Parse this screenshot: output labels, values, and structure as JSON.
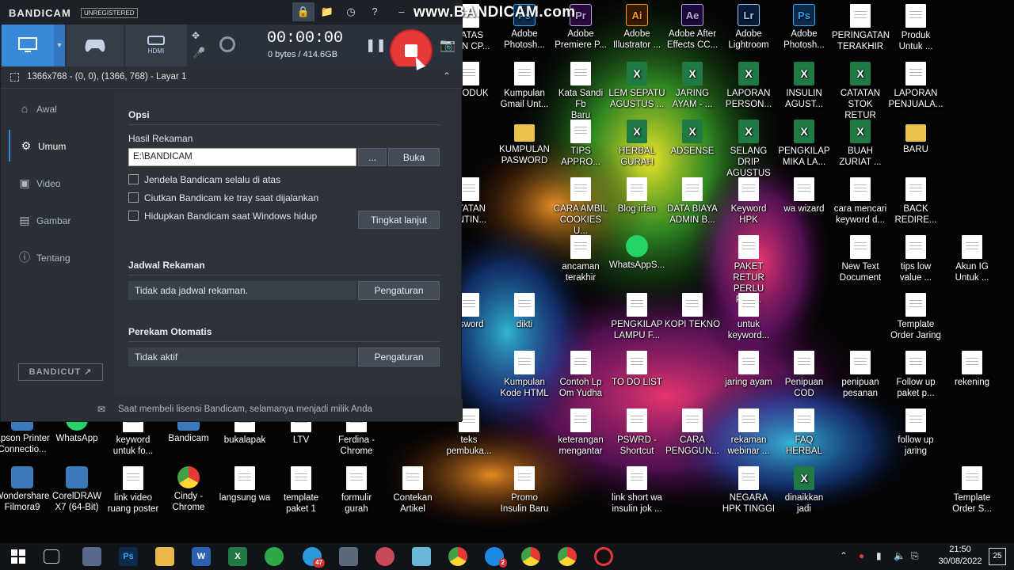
{
  "colors": {
    "accent": "#3a88d8",
    "record": "#e8393a",
    "panel": "#2b2f36"
  },
  "watermark": "www.BANDICAM.com",
  "bandicam": {
    "logo": "BANDICAM",
    "unregistered": "UNREGISTERED",
    "titlebar_icons": [
      "lock-icon",
      "folder-icon",
      "clock-icon",
      "help-icon",
      "minimize-icon"
    ],
    "modes": {
      "hdmi_label": "HDMI"
    },
    "timer": "00:00:00",
    "size": "0 bytes / 414.6GB",
    "area": "1366x768 - (0, 0), (1366, 768) - Layar 1",
    "sidebar": [
      {
        "label": "Awal",
        "icon": "home-icon"
      },
      {
        "label": "Umum",
        "icon": "gear-icon",
        "active": true
      },
      {
        "label": "Video",
        "icon": "video-icon"
      },
      {
        "label": "Gambar",
        "icon": "image-icon"
      },
      {
        "label": "Tentang",
        "icon": "info-icon"
      }
    ],
    "bandicut": "BANDICUT",
    "content": {
      "opsi_title": "Opsi",
      "hasil_label": "Hasil Rekaman",
      "path_value": "E:\\BANDICAM",
      "browse_label": "...",
      "buka_label": "Buka",
      "checks": [
        "Jendela Bandicam selalu di atas",
        "Ciutkan Bandicam ke tray saat dijalankan",
        "Hidupkan Bandicam saat Windows hidup"
      ],
      "advanced_label": "Tingkat lanjut",
      "schedule_title": "Jadwal Rekaman",
      "schedule_value": "Tidak ada jadwal rekaman.",
      "schedule_btn": "Pengaturan",
      "auto_title": "Perekam Otomatis",
      "auto_value": "Tidak aktif",
      "auto_btn": "Pengaturan"
    },
    "footer": "Saat membeli lisensi Bandicam, selamanya menjadi milik Anda"
  },
  "desktop_icons": [
    {
      "label": "BATAS\nMAN CP...",
      "type": "doc"
    },
    {
      "label": "Adobe\nPhotosh...",
      "type": "ps"
    },
    {
      "label": "Adobe\nPremiere P...",
      "type": "pr"
    },
    {
      "label": "Adobe\nIllustrator ...",
      "type": "ai"
    },
    {
      "label": "Adobe After\nEffects CC...",
      "type": "ae"
    },
    {
      "label": "Adobe\nLightroom",
      "type": "lr"
    },
    {
      "label": "Adobe\nPhotosh...",
      "type": "ps"
    },
    {
      "label": "PERINGATAN\nTERAKHIR",
      "type": "doc"
    },
    {
      "label": "Produk\nUntuk ...",
      "type": "doc"
    },
    {
      "label": "PRODUK",
      "type": "doc"
    },
    {
      "label": "Kumpulan\nGmail Unt...",
      "type": "doc"
    },
    {
      "label": "Kata Sandi Fb\nBaru",
      "type": "doc"
    },
    {
      "label": "LEM SEPATU\nAGUSTUS ...",
      "type": "xls"
    },
    {
      "label": "JARING\nAYAM - ...",
      "type": "xls"
    },
    {
      "label": "LAPORAN\nPERSON...",
      "type": "xls"
    },
    {
      "label": "INSULIN\nAGUST...",
      "type": "xls"
    },
    {
      "label": "CATATAN\nSTOK RETUR",
      "type": "xls"
    },
    {
      "label": "LAPORAN\nPENJUALA...",
      "type": "doc"
    },
    {
      "label": "KUMPULAN\nPASWORD",
      "type": "folder"
    },
    {
      "label": "TIPS\nAPPRO...",
      "type": "doc"
    },
    {
      "label": "HERBAL\nGURAH",
      "type": "xls"
    },
    {
      "label": "ADSENSE",
      "type": "xls"
    },
    {
      "label": "SELANG DRIP\nAGUSTUS 2...",
      "type": "xls"
    },
    {
      "label": "PENGKILAP\nMIKA LA...",
      "type": "xls"
    },
    {
      "label": "BUAH\nZURIAT ...",
      "type": "xls"
    },
    {
      "label": "BARU",
      "type": "folder"
    },
    {
      "label": "ATATAN\nENTIN...",
      "type": "doc"
    },
    {
      "label": "CARA AMBIL\nCOOKIES U...",
      "type": "doc"
    },
    {
      "label": "Blog irfan",
      "type": "doc"
    },
    {
      "label": "DATA BIAYA\nADMIN B...",
      "type": "doc"
    },
    {
      "label": "Keyword\nHPK",
      "type": "doc"
    },
    {
      "label": "wa wizard",
      "type": "doc"
    },
    {
      "label": "cara mencari\nkeyword d...",
      "type": "doc"
    },
    {
      "label": "BACK\nREDIRE...",
      "type": "doc"
    },
    {
      "label": "ancaman\nterakhir",
      "type": "doc"
    },
    {
      "label": "WhatsAppS...",
      "type": "wa"
    },
    {
      "label": "PAKET RETUR\nPERLU PAN...",
      "type": "doc"
    },
    {
      "label": "New Text\nDocument",
      "type": "doc"
    },
    {
      "label": "tips low\nvalue ...",
      "type": "doc"
    },
    {
      "label": "Akun IG\nUntuk ...",
      "type": "doc"
    },
    {
      "label": "asword",
      "type": "doc"
    },
    {
      "label": "dikti",
      "type": "doc"
    },
    {
      "label": "PENGKILAP\nLAMPU F...",
      "type": "doc"
    },
    {
      "label": "KOPI TEKNO",
      "type": "doc"
    },
    {
      "label": "untuk\nkeyword...",
      "type": "doc"
    },
    {
      "label": "Template\nOrder Jaring",
      "type": "doc"
    },
    {
      "label": "Kumpulan\nKode HTML",
      "type": "doc"
    },
    {
      "label": "Contoh Lp\nOm Yudha",
      "type": "doc"
    },
    {
      "label": "TO DO LIST",
      "type": "doc"
    },
    {
      "label": "jaring ayam",
      "type": "doc"
    },
    {
      "label": "Penipuan\nCOD",
      "type": "doc"
    },
    {
      "label": "penipuan\npesanan",
      "type": "doc"
    },
    {
      "label": "Follow up\npaket p...",
      "type": "doc"
    },
    {
      "label": "rekening",
      "type": "doc"
    },
    {
      "label": "Epson Printer\nConnectio...",
      "type": "app"
    },
    {
      "label": "WhatsApp",
      "type": "wa"
    },
    {
      "label": "keyword\nuntuk fo...",
      "type": "doc"
    },
    {
      "label": "Bandicam",
      "type": "app"
    },
    {
      "label": "bukalapak",
      "type": "doc"
    },
    {
      "label": "LTV",
      "type": "doc"
    },
    {
      "label": "Ferdina -\nChrome",
      "type": "doc"
    },
    {
      "label": "teks\npembuka...",
      "type": "doc"
    },
    {
      "label": "keterangan\nmengantar",
      "type": "doc"
    },
    {
      "label": "PSWRD -\nShortcut",
      "type": "doc"
    },
    {
      "label": "CARA\nPENGGUN...",
      "type": "doc"
    },
    {
      "label": "rekaman\nwebinar ...",
      "type": "doc"
    },
    {
      "label": "FAQ HERBAL",
      "type": "doc"
    },
    {
      "label": "follow up\njaring",
      "type": "doc"
    },
    {
      "label": "Wondershare\nFilmora9",
      "type": "app"
    },
    {
      "label": "CorelDRAW\nX7 (64-Bit)",
      "type": "app"
    },
    {
      "label": "link video\nruang poster",
      "type": "doc"
    },
    {
      "label": "Cindy -\nChrome",
      "type": "chrome"
    },
    {
      "label": "langsung wa",
      "type": "doc"
    },
    {
      "label": "template\npaket 1",
      "type": "doc"
    },
    {
      "label": "formulir\ngurah",
      "type": "doc"
    },
    {
      "label": "Contekan\nArtikel",
      "type": "doc"
    },
    {
      "label": "Promo\nInsulin Baru",
      "type": "doc"
    },
    {
      "label": "link short wa\ninsulin jok ...",
      "type": "doc"
    },
    {
      "label": "NEGARA\nHPK TINGGI",
      "type": "doc"
    },
    {
      "label": "dinaikkan\njadi",
      "type": "xls"
    },
    {
      "label": "Template\nOrder S...",
      "type": "doc"
    }
  ],
  "taskbar": {
    "ps_label": "Ps",
    "word_label": "W",
    "excel_label": "X",
    "telegram_badge": "47",
    "messenger_badge": "2",
    "time": "21:50",
    "date": "30/08/2022",
    "notif_count": "25"
  }
}
